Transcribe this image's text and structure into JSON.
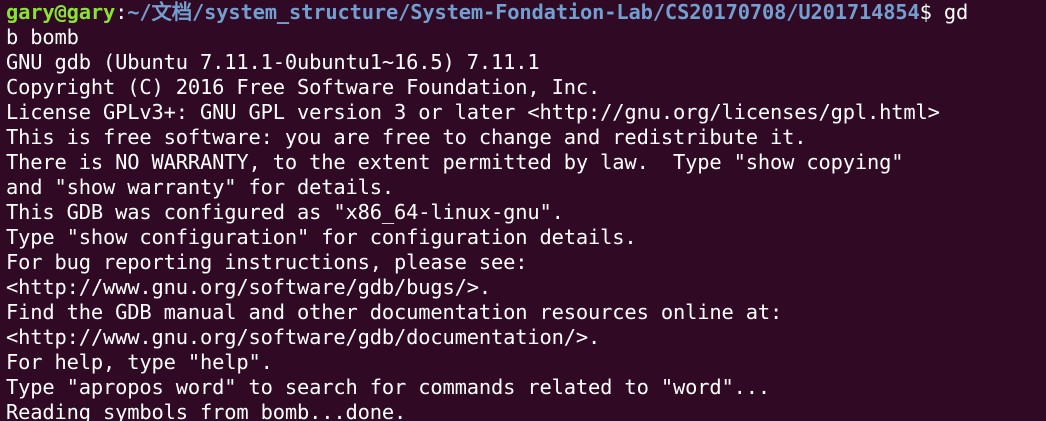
{
  "colors": {
    "background": "#300a24",
    "foreground": "#ffffff",
    "prompt_user": "#8ae234",
    "prompt_path": "#729fcf"
  },
  "prompt": {
    "user_host": "gary@gary",
    "colon": ":",
    "path": "~/文档/system_structure/System-Fondation-Lab/CS20170708/U201714854",
    "dollar": "$ ",
    "command_part1": "gd",
    "command_part2": "b bomb"
  },
  "output_lines": [
    "GNU gdb (Ubuntu 7.11.1-0ubuntu1~16.5) 7.11.1",
    "Copyright (C) 2016 Free Software Foundation, Inc.",
    "License GPLv3+: GNU GPL version 3 or later <http://gnu.org/licenses/gpl.html>",
    "This is free software: you are free to change and redistribute it.",
    "There is NO WARRANTY, to the extent permitted by law.  Type \"show copying\"",
    "and \"show warranty\" for details.",
    "This GDB was configured as \"x86_64-linux-gnu\".",
    "Type \"show configuration\" for configuration details.",
    "For bug reporting instructions, please see:",
    "<http://www.gnu.org/software/gdb/bugs/>.",
    "Find the GDB manual and other documentation resources online at:",
    "<http://www.gnu.org/software/gdb/documentation/>.",
    "For help, type \"help\".",
    "Type \"apropos word\" to search for commands related to \"word\"...",
    "Reading symbols from bomb...done."
  ]
}
